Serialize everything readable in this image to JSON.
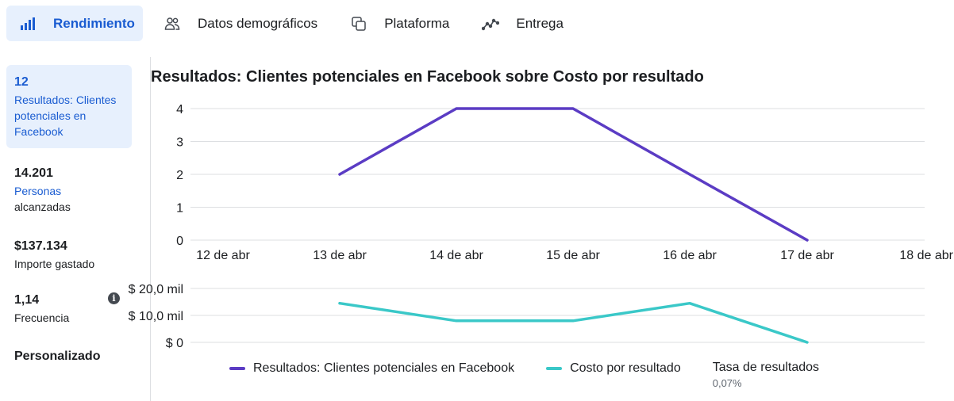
{
  "tabs": [
    {
      "label": "Rendimiento",
      "icon": "bar-chart-icon",
      "active": true
    },
    {
      "label": "Datos demográficos",
      "icon": "people-icon",
      "active": false
    },
    {
      "label": "Plataforma",
      "icon": "stacked-squares-icon",
      "active": false
    },
    {
      "label": "Entrega",
      "icon": "line-trend-icon",
      "active": false
    }
  ],
  "metrics": {
    "results": {
      "value": "12",
      "label": "Resultados: Clientes potenciales en Facebook"
    },
    "people": {
      "value": "14.201",
      "label_line1": "Personas",
      "label_line2": "alcanzadas"
    },
    "spent": {
      "value": "$137.134",
      "label": "Importe gastado"
    },
    "frequency": {
      "value": "1,14",
      "label": "Frecuencia"
    },
    "custom": {
      "label": "Personalizado"
    }
  },
  "chart": {
    "title": "Resultados: Clientes potenciales en Facebook sobre Costo por resultado"
  },
  "legend": {
    "results": "Resultados: Clientes potenciales en Facebook",
    "cost": "Costo por resultado",
    "rate_label": "Tasa de resultados",
    "rate_value": "0,07%"
  },
  "colors": {
    "accent": "#1a5cd1",
    "selected_bg": "#e7f0fd",
    "results_series": "#5b3cc4",
    "cost_series": "#3ac8c8"
  },
  "chart_data": [
    {
      "type": "line",
      "title": "Resultados: Clientes potenciales en Facebook sobre Costo por resultado",
      "categories": [
        "12 de abr",
        "13 de abr",
        "14 de abr",
        "15 de abr",
        "16 de abr",
        "17 de abr",
        "18 de abr"
      ],
      "y_ticks": [
        "0",
        "1",
        "2",
        "3",
        "4"
      ],
      "ylim": [
        0,
        4
      ],
      "grid": true,
      "series": [
        {
          "name": "Resultados: Clientes potenciales en Facebook",
          "values": [
            null,
            2,
            4,
            4,
            2,
            0,
            null
          ]
        }
      ]
    },
    {
      "type": "line",
      "categories": [
        "12 de abr",
        "13 de abr",
        "14 de abr",
        "15 de abr",
        "16 de abr",
        "17 de abr",
        "18 de abr"
      ],
      "y_ticks": [
        "$ 0",
        "$ 10,0 mil",
        "$ 20,0 mil"
      ],
      "ylim": [
        0,
        20000
      ],
      "grid": true,
      "series": [
        {
          "name": "Costo por resultado",
          "values": [
            null,
            14500,
            8000,
            8000,
            14500,
            0,
            null
          ]
        }
      ]
    }
  ]
}
